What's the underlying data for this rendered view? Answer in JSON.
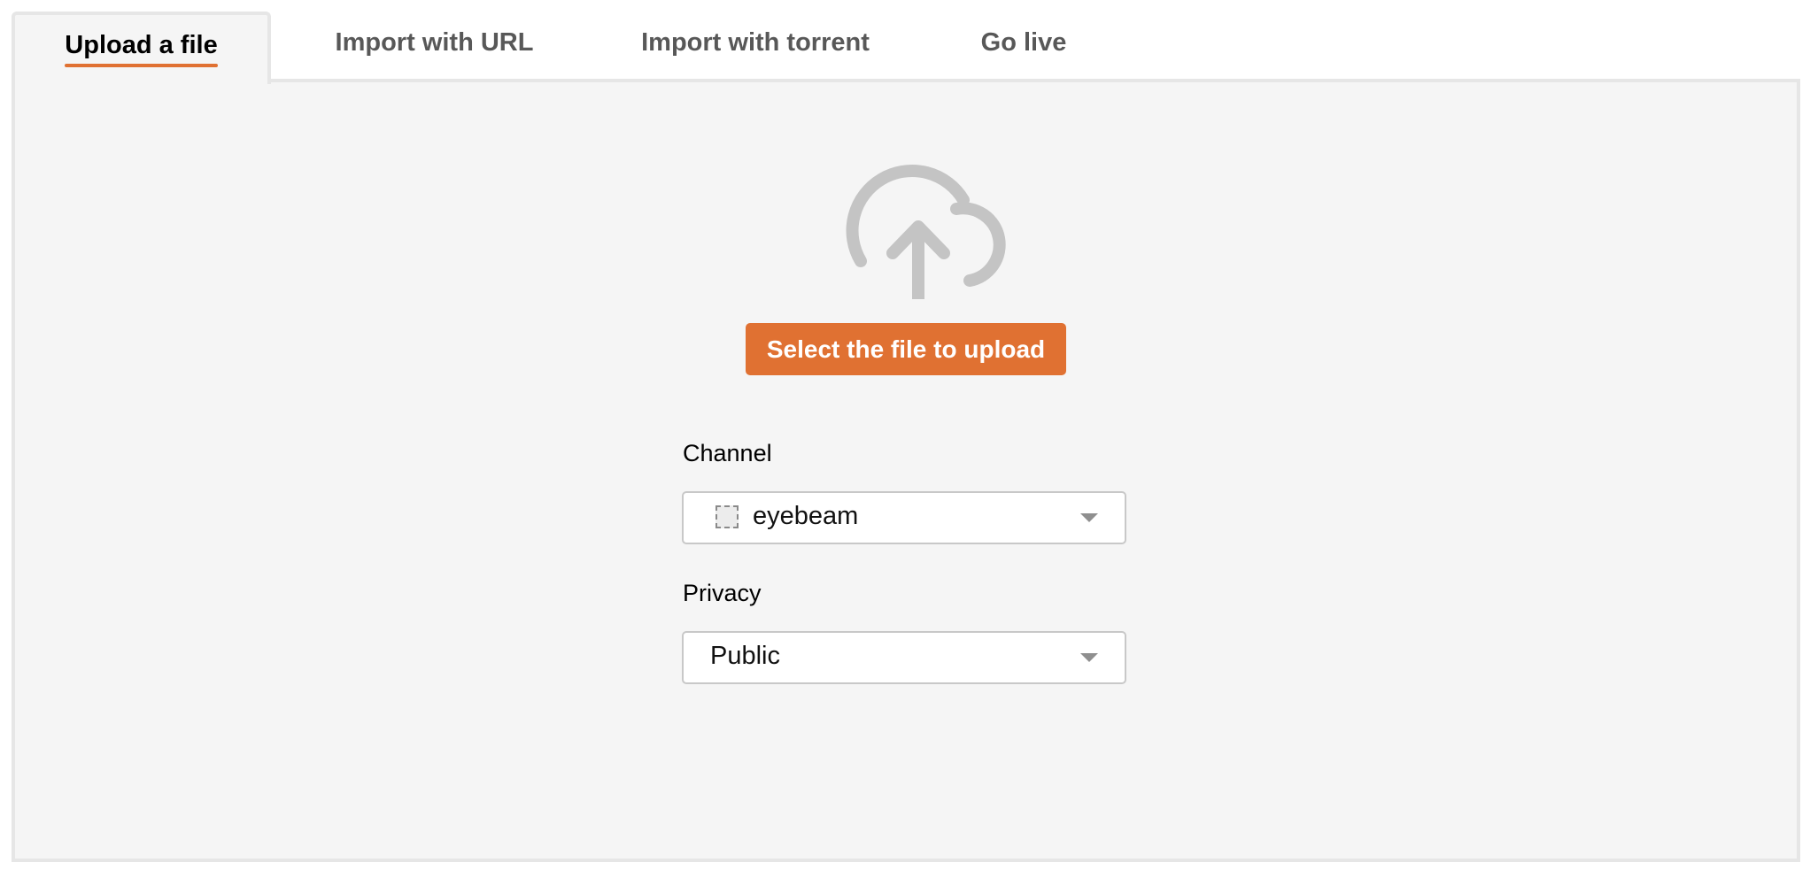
{
  "tabs": [
    {
      "label": "Upload a file",
      "active": true
    },
    {
      "label": "Import with URL",
      "active": false
    },
    {
      "label": "Import with torrent",
      "active": false
    },
    {
      "label": "Go live",
      "active": false
    }
  ],
  "upload": {
    "icon": "cloud-upload-icon",
    "button_label": "Select the file to upload"
  },
  "channel": {
    "label": "Channel",
    "selected": "eyebeam",
    "avatar_icon": "channel-avatar"
  },
  "privacy": {
    "label": "Privacy",
    "selected": "Public"
  },
  "colors": {
    "accent": "#e07132",
    "panel_bg": "#f5f5f5",
    "border": "#e6e6e6",
    "icon_gray": "#c4c4c4"
  }
}
